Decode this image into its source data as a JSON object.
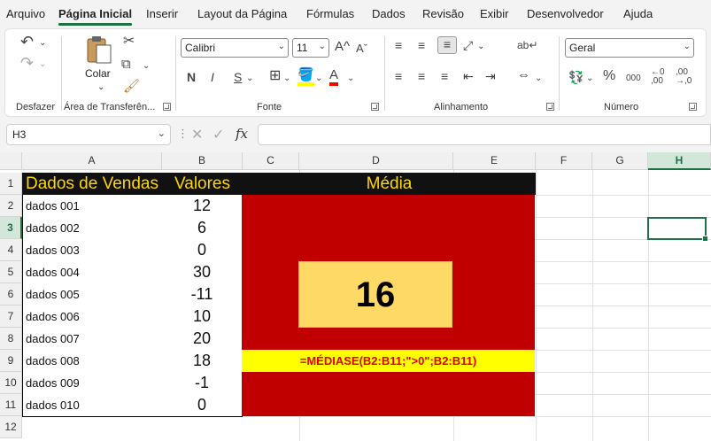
{
  "menu": {
    "items": [
      "Arquivo",
      "Página Inicial",
      "Inserir",
      "Layout da Página",
      "Fórmulas",
      "Dados",
      "Revisão",
      "Exibir",
      "Desenvolvedor",
      "Ajuda"
    ],
    "active": "Página Inicial"
  },
  "ribbon": {
    "groups": {
      "undo": "Desfazer",
      "clipboard": "Área de Transferên...",
      "font": "Fonte",
      "alignment": "Alinhamento",
      "number": "Número"
    },
    "paste_label": "Colar",
    "font_name": "Calibri",
    "font_size": "11",
    "number_format": "Geral",
    "bold": "N",
    "italic": "I",
    "underline": "S",
    "grow_font": "A^",
    "shrink_font": "Aˇ",
    "percent": "%",
    "thousands": "000"
  },
  "formula_bar": {
    "name_box": "H3",
    "fx": "fx",
    "formula": ""
  },
  "grid": {
    "columns": [
      "A",
      "B",
      "C",
      "D",
      "E",
      "F",
      "G",
      "H"
    ],
    "rows": [
      "1",
      "2",
      "3",
      "4",
      "5",
      "6",
      "7",
      "8",
      "9",
      "10",
      "11",
      "12"
    ],
    "selected_column": "H",
    "selected_row": "3",
    "headers": {
      "a": "Dados de Vendas",
      "b": "Valores",
      "merged": "Média"
    },
    "data": [
      {
        "label": "dados 001",
        "value": "12"
      },
      {
        "label": "dados 002",
        "value": "6"
      },
      {
        "label": "dados 003",
        "value": "0"
      },
      {
        "label": "dados 004",
        "value": "30"
      },
      {
        "label": "dados 005",
        "value": "-11"
      },
      {
        "label": "dados 006",
        "value": "10"
      },
      {
        "label": "dados 007",
        "value": "20"
      },
      {
        "label": "dados 008",
        "value": "18"
      },
      {
        "label": "dados 009",
        "value": "-1"
      },
      {
        "label": "dados 010",
        "value": "0"
      }
    ],
    "result": "16",
    "formula_text": "=MÉDIASE(B2:B11;\">0\";B2:B11)"
  },
  "colors": {
    "accent": "#1e7145",
    "header_bg": "#111111",
    "header_text": "#ffd700",
    "panel_red": "#c00000",
    "result_box": "#ffd966",
    "formula_strip": "#ffff00",
    "formula_text": "#e00000"
  }
}
